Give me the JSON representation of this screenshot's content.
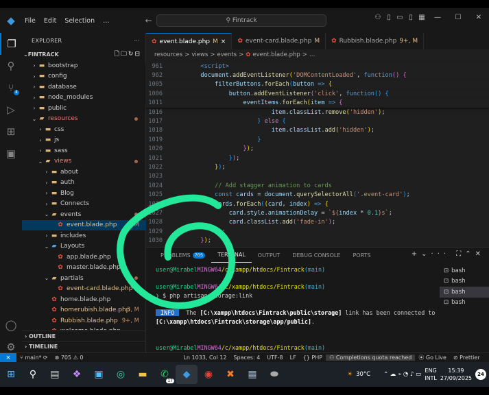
{
  "titlebar": {
    "menu": [
      "File",
      "Edit",
      "Selection",
      "…"
    ],
    "search": "Fintrack",
    "back": "←",
    "forward": "→"
  },
  "sidebar": {
    "header": "EXPLORER",
    "section": "FINTRACK",
    "items": [
      {
        "label": "bootstrap",
        "indent": 1,
        "type": "folder",
        "open": false
      },
      {
        "label": "config",
        "indent": 1,
        "type": "folder",
        "open": false
      },
      {
        "label": "database",
        "indent": 1,
        "type": "folder",
        "open": false
      },
      {
        "label": "node_modules",
        "indent": 1,
        "type": "folder",
        "open": false
      },
      {
        "label": "public",
        "indent": 1,
        "type": "folder",
        "open": false
      },
      {
        "label": "resources",
        "indent": 1,
        "type": "folder",
        "open": true,
        "dot": true,
        "red": true
      },
      {
        "label": "css",
        "indent": 2,
        "type": "folder",
        "open": false
      },
      {
        "label": "js",
        "indent": 2,
        "type": "folder",
        "open": false
      },
      {
        "label": "sass",
        "indent": 2,
        "type": "folder",
        "open": false
      },
      {
        "label": "views",
        "indent": 2,
        "type": "folder",
        "open": true,
        "dot": true,
        "red": true
      },
      {
        "label": "about",
        "indent": 3,
        "type": "folder",
        "open": false
      },
      {
        "label": "auth",
        "indent": 3,
        "type": "folder",
        "open": false
      },
      {
        "label": "Blog",
        "indent": 3,
        "type": "folder",
        "open": false
      },
      {
        "label": "Connects",
        "indent": 3,
        "type": "folder",
        "open": false
      },
      {
        "label": "events",
        "indent": 3,
        "type": "folder",
        "open": true,
        "dot": true
      },
      {
        "label": "event.blade.php",
        "indent": 4,
        "type": "blade",
        "status": "M",
        "selected": true
      },
      {
        "label": "includes",
        "indent": 3,
        "type": "folder",
        "open": false
      },
      {
        "label": "Layouts",
        "indent": 3,
        "type": "folderb",
        "open": true
      },
      {
        "label": "app.blade.php",
        "indent": 4,
        "type": "blade"
      },
      {
        "label": "master.blade.php",
        "indent": 4,
        "type": "blade"
      },
      {
        "label": "partials",
        "indent": 3,
        "type": "folder",
        "open": true,
        "dot": true
      },
      {
        "label": "event-card.blade.php",
        "indent": 4,
        "type": "blade",
        "status": "M"
      },
      {
        "label": "home.blade.php",
        "indent": 3,
        "type": "blade"
      },
      {
        "label": "homerubish.blade.php",
        "indent": 3,
        "type": "blade",
        "status": "3, M",
        "red": true
      },
      {
        "label": "Rubbish.blade.php",
        "indent": 3,
        "type": "blade",
        "status": "9+, M",
        "red": true
      },
      {
        "label": "welcome.blade.php",
        "indent": 3,
        "type": "blade"
      }
    ],
    "outline": "OUTLINE",
    "timeline": "TIMELINE"
  },
  "tabs": [
    {
      "label": "event.blade.php",
      "mod": "M",
      "close": "×",
      "active": true
    },
    {
      "label": "event-card.blade.php",
      "mod": "M",
      "active": false
    },
    {
      "label": "Rubbish.blade.php",
      "mod": "9+, M",
      "active": false
    }
  ],
  "breadcrumbs": [
    "resources",
    ">",
    "views",
    ">",
    "events",
    ">",
    "event.blade.php",
    ">",
    "…"
  ],
  "code": [
    {
      "n": "961",
      "h": "<span class='k'>        &lt;script&gt;</span>"
    },
    {
      "n": "962",
      "h": "        <span class='v'>document</span>.<span class='f'>addEventListener</span><span class='b1'>(</span><span class='s'>'DOMContentLoaded'</span>, <span class='k'>function</span><span class='b2'>()</span> <span class='b2'>{</span>"
    },
    {
      "n": "1005",
      "h": "            <span class='v'>filterButtons</span>.<span class='f'>forEach</span><span class='b3'>(</span><span class='v'>button</span> <span class='k'>=&gt;</span> <span class='b1'>{</span>"
    },
    {
      "n": "1006",
      "h": "                <span class='v'>button</span>.<span class='f'>addEventListener</span><span class='b2'>(</span><span class='s'>'click'</span>, <span class='k'>function</span><span class='b3'>()</span> <span class='b3'>{</span>"
    },
    {
      "n": "1011",
      "h": "                    <span class='v'>eventItems</span>.<span class='f'>forEach</span><span class='b1'>(</span><span class='v'>item</span> <span class='k'>=&gt;</span> <span class='b2'>{</span>"
    },
    {
      "n": "1016",
      "h": "                            <span class='v'>item</span>.<span class='v'>classList</span>.<span class='f'>remove</span><span class='b1'>(</span><span class='s'>'hidden'</span><span class='b1'>)</span>;"
    },
    {
      "n": "1017",
      "h": "                        <span class='b3'>}</span> <span class='p'>else</span> <span class='b3'>{</span>"
    },
    {
      "n": "1018",
      "h": "                            <span class='v'>item</span>.<span class='v'>classList</span>.<span class='f'>add</span><span class='b1'>(</span><span class='s'>'hidden'</span><span class='b1'>)</span>;"
    },
    {
      "n": "1019",
      "h": "                        <span class='b3'>}</span>"
    },
    {
      "n": "1020",
      "h": "                    <span class='b2'>}</span><span class='b1'>)</span>;"
    },
    {
      "n": "1021",
      "h": "                <span class='b3'>}</span><span class='b2'>)</span>;"
    },
    {
      "n": "1022",
      "h": "            <span class='b1'>}</span><span class='b3'>)</span>;"
    },
    {
      "n": "1023",
      "h": " "
    },
    {
      "n": "1024",
      "h": "            <span class='c'>// Add stagger animation to cards</span>"
    },
    {
      "n": "1025",
      "h": "            <span class='k'>const</span> <span class='v'>cards</span> = <span class='v'>document</span>.<span class='f'>querySelectorAll</span><span class='b3'>(</span><span class='s'>'.event-card'</span><span class='b3'>)</span>;"
    },
    {
      "n": "1026",
      "h": "            <span class='v'>cards</span>.<span class='f'>forEach</span><span class='b3'>(</span><span class='b1'>(</span><span class='v'>card</span>, <span class='v'>index</span><span class='b1'>)</span> <span class='k'>=&gt;</span> <span class='b1'>{</span>"
    },
    {
      "n": "1027",
      "h": "                <span class='v'>card</span>.<span class='v'>style</span>.<span class='v'>animationDelay</span> = <span class='s'>`${</span><span class='v'>index</span> * <span class='t'>0.1</span><span class='s'>}s`</span>;"
    },
    {
      "n": "1028",
      "h": "                <span class='v'>card</span>.<span class='v'>classList</span>.<span class='f'>add</span><span class='b2'>(</span><span class='s'>'fade-in'</span><span class='b2'>)</span>;"
    },
    {
      "n": "1029",
      "h": "            <span class='b1'>}</span><span class='b3'>)</span>;"
    },
    {
      "n": "1030",
      "h": "        <span class='b2'>}</span><span class='b1'>)</span>;"
    }
  ],
  "panel": {
    "tabs": [
      {
        "label": "PROBLEMS",
        "badge": "705"
      },
      {
        "label": "TERMINAL",
        "active": true
      },
      {
        "label": "OUTPUT"
      },
      {
        "label": "DEBUG CONSOLE"
      },
      {
        "label": "PORTS"
      }
    ],
    "terminal": [
      {
        "h": "<span class='g'>user@Mirabel</span> <span class='mg'>MINGW64</span> <span class='y'>/c/xampp/htdocs/Fintrack</span> <span class='cy'>(main)</span>"
      },
      {
        "h": " "
      },
      {
        "h": "<span class='g'>user@Mirabel</span> <span class='mg'>MINGW64</span> <span class='y'>/c/xampp/htdocs/Fintrack</span> <span class='cy'>(main)</span>"
      },
      {
        "h": "<span class='gray'>❯</span> $ php artisan storage:link"
      },
      {
        "h": " "
      },
      {
        "h": "  <span class='info'> INFO </span>  The <span class='wh'>[C:\\xampp\\htdocs\\Fintrack\\public\\storage]</span> link has been connected to"
      },
      {
        "h": " <span class='wh'>[C:\\xampp\\htdocs\\Fintrack\\storage\\app/public]</span>."
      },
      {
        "h": " "
      },
      {
        "h": " "
      },
      {
        "h": "<span class='g'>user@Mirabel</span> <span class='mg'>MINGW64</span> <span class='y'>/c/xampp/htdocs/Fintrack</span> <span class='cy'>(main)</span>"
      },
      {
        "h": "<span class='gray'>❯</span> $ <span style='background:#ccc'> </span>"
      }
    ],
    "sessions": [
      "bash",
      "bash",
      "bash",
      "bash"
    ]
  },
  "status": {
    "remote": "⨯",
    "branch": "main*",
    "sync": "⟳",
    "errors": "⊗ 705 ⚠ 0",
    "cursor": "Ln 1033, Col 12",
    "spaces": "Spaces: 4",
    "enc": "UTF-8",
    "eol": "LF",
    "lang": "PHP",
    "quota": "Completions quota reached",
    "golive": "Go Live",
    "prettier": "Prettier"
  },
  "taskbar": {
    "weather": "30°C",
    "lang1": "ENG",
    "lang2": "INTL",
    "time": "15:39",
    "date": "27/09/2025",
    "notif": "24",
    "wa_badge": "17"
  },
  "colors": {
    "accent": "#0078d4",
    "annotation": "#23e89a"
  }
}
